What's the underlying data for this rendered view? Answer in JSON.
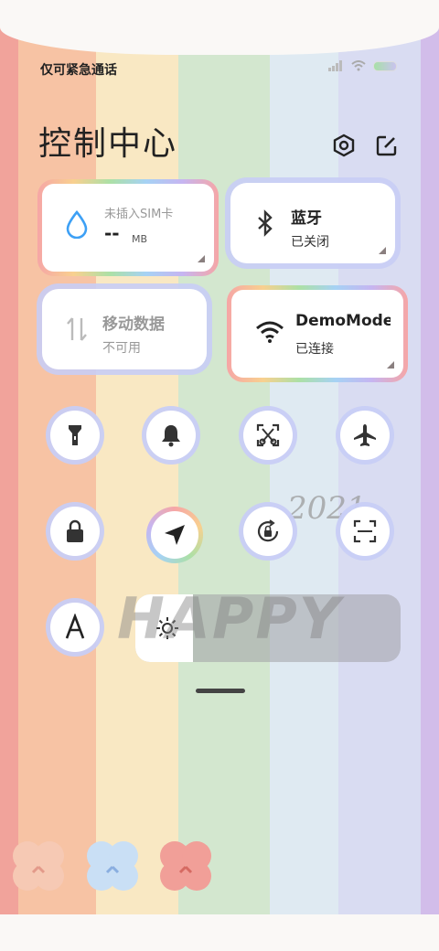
{
  "status_bar": {
    "carrier_text": "仅可紧急通话"
  },
  "header": {
    "title": "控制中心"
  },
  "cards": {
    "sim": {
      "line1": "未插入SIM卡",
      "value": "--",
      "unit": "MB"
    },
    "bluetooth": {
      "label": "蓝牙",
      "status": "已关闭"
    },
    "mobile_data": {
      "label": "移动数据",
      "status": "不可用"
    },
    "wifi": {
      "label": "DemoMode",
      "status": "已连接"
    }
  },
  "decor": {
    "happy_text": "HAPPY",
    "year_text": "2021"
  },
  "colors": {
    "accent_blue": "#3da0f5",
    "icon_gray": "#333333",
    "disabled_gray": "#bbbbbb"
  },
  "icons": [
    "flashlight-icon",
    "bell-icon",
    "screenshot-icon",
    "airplane-icon",
    "lock-icon",
    "location-icon",
    "rotation-lock-icon",
    "scan-icon",
    "font-a-icon",
    "brightness-icon"
  ]
}
